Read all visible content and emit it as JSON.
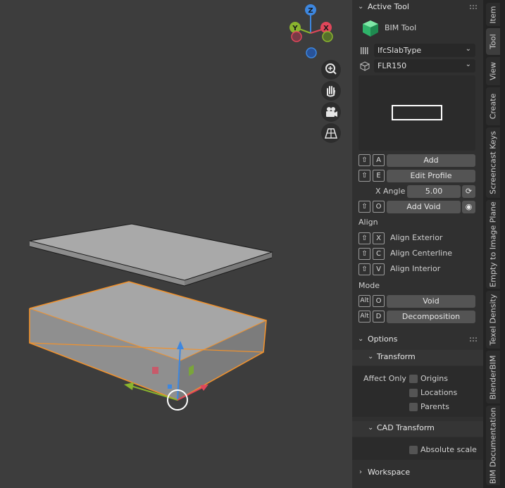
{
  "viewport": {
    "gizmo_labels": {
      "z": "Z",
      "y": "Y",
      "x": "X"
    },
    "nav_icons": [
      "zoom-icon",
      "hand-pan-icon",
      "camera-icon",
      "grid-perspective-icon"
    ]
  },
  "sidebar": {
    "active_tool": {
      "header": "Active Tool",
      "tool_name": "BIM Tool",
      "type_select": "IfcSlabType",
      "profile_select": "FLR150",
      "add_key": "A",
      "add_label": "Add",
      "edit_key": "E",
      "edit_label": "Edit Profile",
      "angle_label": "X Angle",
      "angle_value": "5.00",
      "void_key": "O",
      "add_void_label": "Add Void",
      "align_title": "Align",
      "align_items": [
        {
          "key": "X",
          "label": "Align Exterior"
        },
        {
          "key": "C",
          "label": "Align Centerline"
        },
        {
          "key": "V",
          "label": "Align Interior"
        }
      ],
      "mode_title": "Mode",
      "mode_items": [
        {
          "mod": "Alt",
          "key": "O",
          "label": "Void"
        },
        {
          "mod": "Alt",
          "key": "D",
          "label": "Decomposition"
        }
      ]
    },
    "options": {
      "header": "Options",
      "transform_header": "Transform",
      "affect_only": "Affect Only",
      "origins": "Origins",
      "locations": "Locations",
      "parents": "Parents",
      "cad_header": "CAD Transform",
      "absolute_scale": "Absolute scale",
      "workspace": "Workspace"
    }
  },
  "tabs": [
    "Item",
    "Tool",
    "View",
    "Create",
    "Screencast Keys",
    "Empty to Image Plane",
    "Texel Density",
    "BlenderBIM",
    "BIM Documentation"
  ],
  "colors": {
    "accent_orange": "#f0922e",
    "axis_x": "#e0465a",
    "axis_y": "#8ab42e",
    "axis_z": "#3d87e0"
  }
}
